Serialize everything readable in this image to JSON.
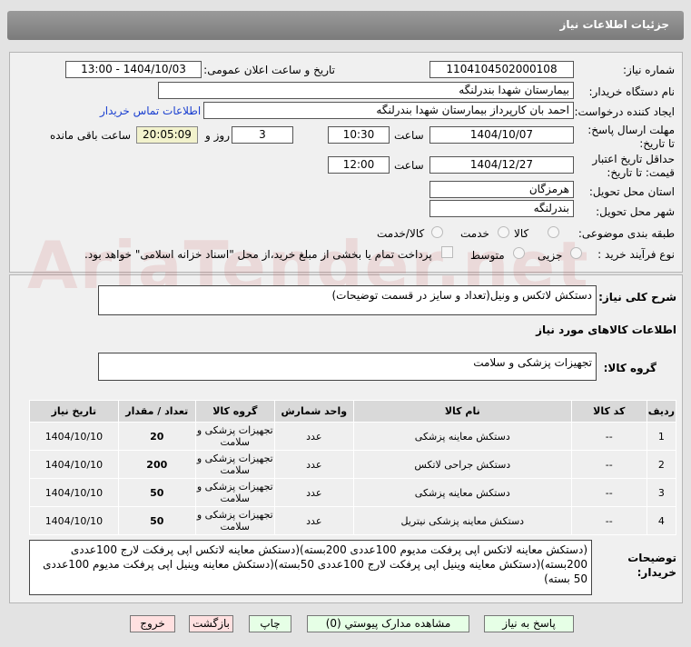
{
  "title": "جزئیات اطلاعات نیاز",
  "fields": {
    "need_number_label": "شماره نیاز:",
    "need_number": "1104104502000108",
    "announce_label": "تاریخ و ساعت اعلان عمومی:",
    "announce_value": "1404/10/03 - 13:00",
    "buyer_org_label": "نام دستگاه خریدار:",
    "buyer_org": "بیمارستان شهدا بندرلنگه",
    "creator_label": "ایجاد کننده درخواست:",
    "creator": "احمد بان کارپرداز بیمارستان شهدا بندرلنگه",
    "contact_link": "اطلاعات تماس خریدار",
    "deadline_label": "مهلت ارسال پاسخ: تا تاریخ:",
    "deadline_date": "1404/10/07",
    "time_label": "ساعت",
    "deadline_time": "10:30",
    "days": "3",
    "days_label": "روز و",
    "remaining": "20:05:09",
    "remaining_label": "ساعت باقی مانده",
    "validity_label": "حداقل تاریخ اعتبار قیمت: تا تاریخ:",
    "validity_date": "1404/12/27",
    "validity_time": "12:00",
    "province_label": "استان محل تحویل:",
    "province": "هرمزگان",
    "city_label": "شهر محل تحویل:",
    "city": "بندرلنگه",
    "category_label": "طبقه بندی موضوعی:",
    "category_options": [
      "کالا",
      "خدمت",
      "کالا/خدمت"
    ],
    "process_label": "نوع فرآیند خرید :",
    "process_options": [
      "جزیی",
      "متوسط"
    ],
    "payment_note": "پرداخت تمام یا بخشی از مبلغ خرید،از محل \"اسناد خزانه اسلامی\" خواهد بود."
  },
  "summary_label": "شرح کلی نیاز:",
  "summary": "دستکش لاتکس و ونیل(تعداد و سایز در قسمت توضیحات)",
  "goods_info_title": "اطلاعات کالاهای مورد نیاز",
  "goods_group_label": "گروه کالا:",
  "goods_group": "تجهیزات پزشکی و سلامت",
  "table": {
    "headers": [
      "ردیف",
      "کد کالا",
      "نام کالا",
      "واحد شمارش",
      "گروه کالا",
      "تعداد / مقدار",
      "تاریخ نیاز"
    ],
    "rows": [
      [
        "1",
        "--",
        "دستکش معاینه پزشکی",
        "عدد",
        "تجهیزات پزشکی و سلامت",
        "20",
        "1404/10/10"
      ],
      [
        "2",
        "--",
        "دستکش جراحی لاتکس",
        "عدد",
        "تجهیزات پزشکی و سلامت",
        "200",
        "1404/10/10"
      ],
      [
        "3",
        "--",
        "دستکش معاینه پزشکی",
        "عدد",
        "تجهیزات پزشکی و سلامت",
        "50",
        "1404/10/10"
      ],
      [
        "4",
        "--",
        "دستکش معاینه پزشکی نیتریل",
        "عدد",
        "تجهیزات پزشکی و سلامت",
        "50",
        "1404/10/10"
      ]
    ]
  },
  "notes_label": "توضیحات خریدار:",
  "notes": "(دستکش معاینه لاتکس اپی پرفکت مدیوم 100عددی 200بسته)(دستکش معاینه لاتکس اپی پرفکت لارج 100عددی 200بسته)(دستکش معاینه وینیل اپی پرفکت لارج 100عددی 50بسته)(دستکش معاینه وینیل اپی پرفکت مدیوم 100عددی 50 بسته)",
  "buttons": {
    "reply": "پاسخ به نیاز",
    "docs": "مشاهده مدارک پیوستي (0)",
    "print": "چاپ",
    "back": "بازگشت",
    "exit": "خروج"
  },
  "watermark": "AriaTender.net"
}
